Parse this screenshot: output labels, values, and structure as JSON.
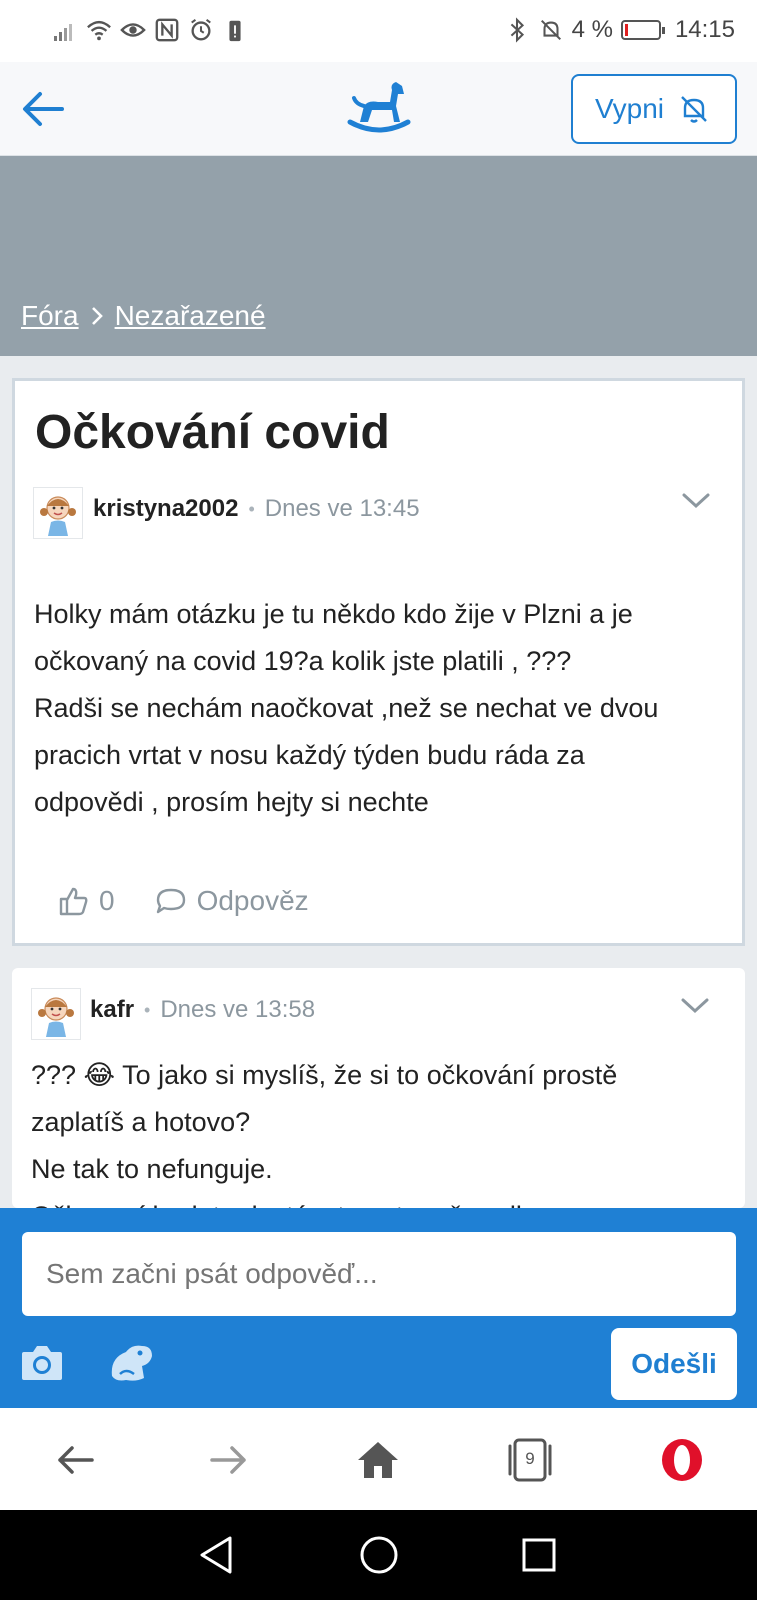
{
  "status_bar": {
    "battery": "4 %",
    "time": "14:15",
    "battery_level": 0.04
  },
  "header": {
    "mute_label": "Vypni"
  },
  "breadcrumb": {
    "items": [
      "Fóra",
      "Nezařazené"
    ]
  },
  "post": {
    "title": "Očkování covid",
    "author": "kristyna2002",
    "time": "Dnes ve 13:45",
    "body_lines": [
      "Holky mám otázku je tu někdo kdo žije v Plzni a je",
      "očkovaný na covid 19?a kolik jste platili , ???",
      "Radši se nechám naočkovat ,než se nechat ve dvou",
      "pracich vrtat v nosu každý týden budu ráda za",
      "odpovědi , prosím hejty si nechte"
    ],
    "likes": "0",
    "reply_label": "Odpověz"
  },
  "reply": {
    "author": "kafr",
    "time": "Dnes ve 13:58",
    "body_lines": [
      "??? 😂 To jako si myslíš, že si to očkování prostě",
      "zaplatíš a hotovo?",
      "Ne tak to nefunguje.",
      "Očkovaní budete dostávat postupně podle"
    ]
  },
  "compose": {
    "placeholder": "Sem začni psát odpověď...",
    "send_label": "Odešli"
  },
  "browser": {
    "tab_count": "9"
  },
  "colors": {
    "accent": "#1f80d4",
    "banner": "#94a1aa",
    "opera_red": "#e0102a"
  }
}
